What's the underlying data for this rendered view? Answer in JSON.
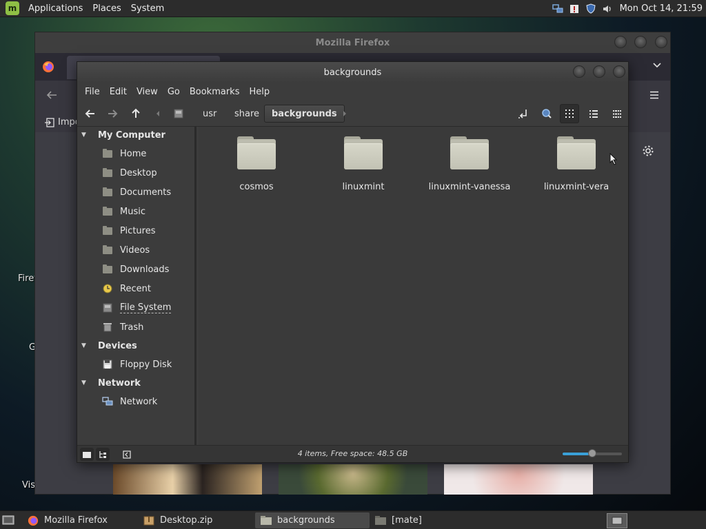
{
  "top_panel": {
    "menu": [
      "Applications",
      "Places",
      "System"
    ],
    "clock": "Mon Oct 14, 21:59"
  },
  "desktop": {
    "labels": [
      "Firef",
      "G",
      "Vis"
    ]
  },
  "firefox": {
    "title": "Mozilla Firefox",
    "bookmark_partial": "Impo"
  },
  "caja": {
    "title": "backgrounds",
    "menu": [
      "File",
      "Edit",
      "View",
      "Go",
      "Bookmarks",
      "Help"
    ],
    "breadcrumbs": [
      "usr",
      "share",
      "backgrounds"
    ],
    "sidebar": {
      "sections": [
        {
          "label": "My Computer",
          "items": [
            "Home",
            "Desktop",
            "Documents",
            "Music",
            "Pictures",
            "Videos",
            "Downloads",
            "Recent",
            "File System",
            "Trash"
          ]
        },
        {
          "label": "Devices",
          "items": [
            "Floppy Disk"
          ]
        },
        {
          "label": "Network",
          "items": [
            "Network"
          ]
        }
      ]
    },
    "files": [
      "cosmos",
      "linuxmint",
      "linuxmint-vanessa",
      "linuxmint-vera"
    ],
    "status": "4 items, Free space: 48.5 GB",
    "zoom_level": 0.5
  },
  "taskbar": {
    "tasks": [
      "Mozilla Firefox",
      "Desktop.zip",
      "backgrounds",
      "[mate]"
    ]
  },
  "colors": {
    "accent": "#3aa0d8",
    "mint": "#8fbf45",
    "folder": "#c8c8ba"
  }
}
